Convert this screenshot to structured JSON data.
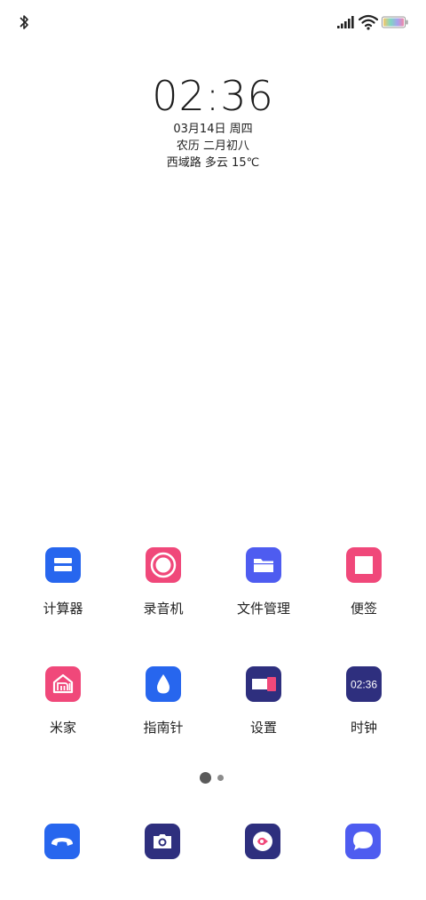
{
  "status_bar": {
    "bluetooth_icon": "bluetooth-icon",
    "signal_icon": "cellular-signal-icon",
    "wifi_icon": "wifi-icon",
    "battery_icon": "battery-icon"
  },
  "clock_widget": {
    "time": "02:36",
    "date": "03月14日 周四",
    "lunar": "农历 二月初八",
    "weather": "西域路 多云 15℃"
  },
  "apps": [
    {
      "label": "计算器",
      "icon": "calculator-icon",
      "color": "#2766ee"
    },
    {
      "label": "录音机",
      "icon": "recorder-icon",
      "color": "#f0487a"
    },
    {
      "label": "文件管理",
      "icon": "folder-icon",
      "color": "#4e5cf0"
    },
    {
      "label": "便签",
      "icon": "notes-icon",
      "color": "#f0487a"
    },
    {
      "label": "米家",
      "icon": "mi-home-icon",
      "color": "#f0487a"
    },
    {
      "label": "指南针",
      "icon": "compass-icon",
      "color": "#2766ee"
    },
    {
      "label": "设置",
      "icon": "settings-icon",
      "color": "#2e2f7e"
    },
    {
      "label": "时钟",
      "icon": "clock-icon",
      "color": "#2e2f7e",
      "icon_text": "02:36"
    }
  ],
  "dock": [
    {
      "icon": "phone-icon",
      "color": "#2766ee"
    },
    {
      "icon": "camera-icon",
      "color": "#2e2f7e"
    },
    {
      "icon": "browser-icon",
      "color": "#2e2f7e"
    },
    {
      "icon": "messages-icon",
      "color": "#4e5cf0"
    }
  ],
  "page_indicator": {
    "current": 1,
    "total": 2
  }
}
